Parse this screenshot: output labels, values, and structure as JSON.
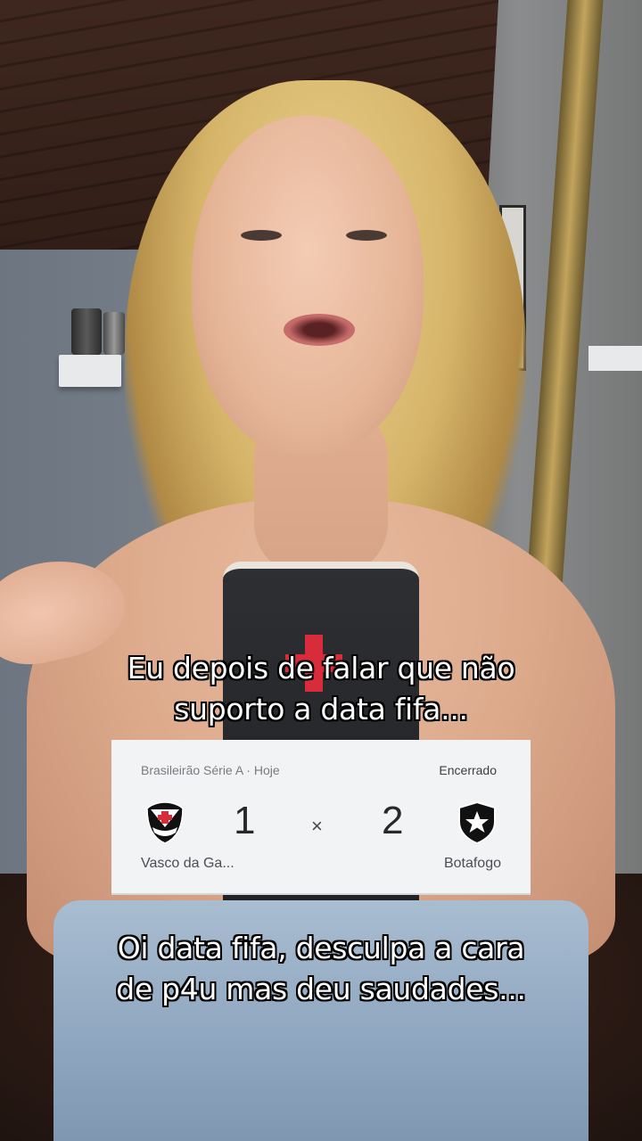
{
  "captions": {
    "top": [
      "Eu depois de falar que não",
      "suporto a data fifa..."
    ],
    "bottom": [
      "Oi data fifa, desculpa a cara",
      "de p4u mas deu saudades..."
    ]
  },
  "score_card": {
    "league": "Brasileirão Série A · Hoje",
    "status": "Encerrado",
    "home_team": {
      "name": "Vasco da Ga...",
      "score": "1",
      "crest_icon": "vasco-crest-icon"
    },
    "separator": "×",
    "away_team": {
      "name": "Botafogo",
      "score": "2",
      "crest_icon": "botafogo-crest-icon"
    }
  },
  "colors": {
    "caption_text": "#ffffff",
    "caption_outline": "#000000",
    "card_background": "#f2f3f5"
  }
}
